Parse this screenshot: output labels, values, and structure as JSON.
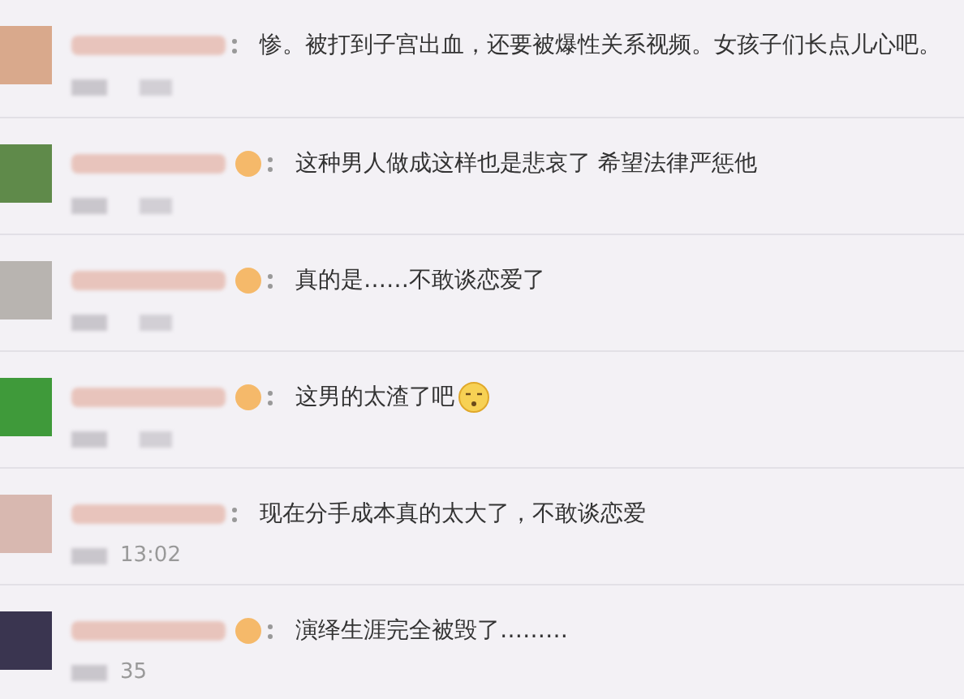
{
  "comments": [
    {
      "badge": false,
      "text": "惨。被打到子宫出血，还要被爆性关系视频。女孩子们长点儿心吧。",
      "emoji": false
    },
    {
      "badge": true,
      "text": "这种男人做成这样也是悲哀了 希望法律严惩他",
      "emoji": false
    },
    {
      "badge": true,
      "text": "真的是……不敢谈恋爱了",
      "emoji": false
    },
    {
      "badge": true,
      "text": "这男的太渣了吧",
      "emoji": true
    },
    {
      "badge": false,
      "text": "现在分手成本真的太大了，不敢谈恋爱",
      "emoji": false,
      "time": "13:02"
    },
    {
      "badge": true,
      "text": "演绎生涯完全被毁了………",
      "emoji": false,
      "time": "35"
    }
  ]
}
